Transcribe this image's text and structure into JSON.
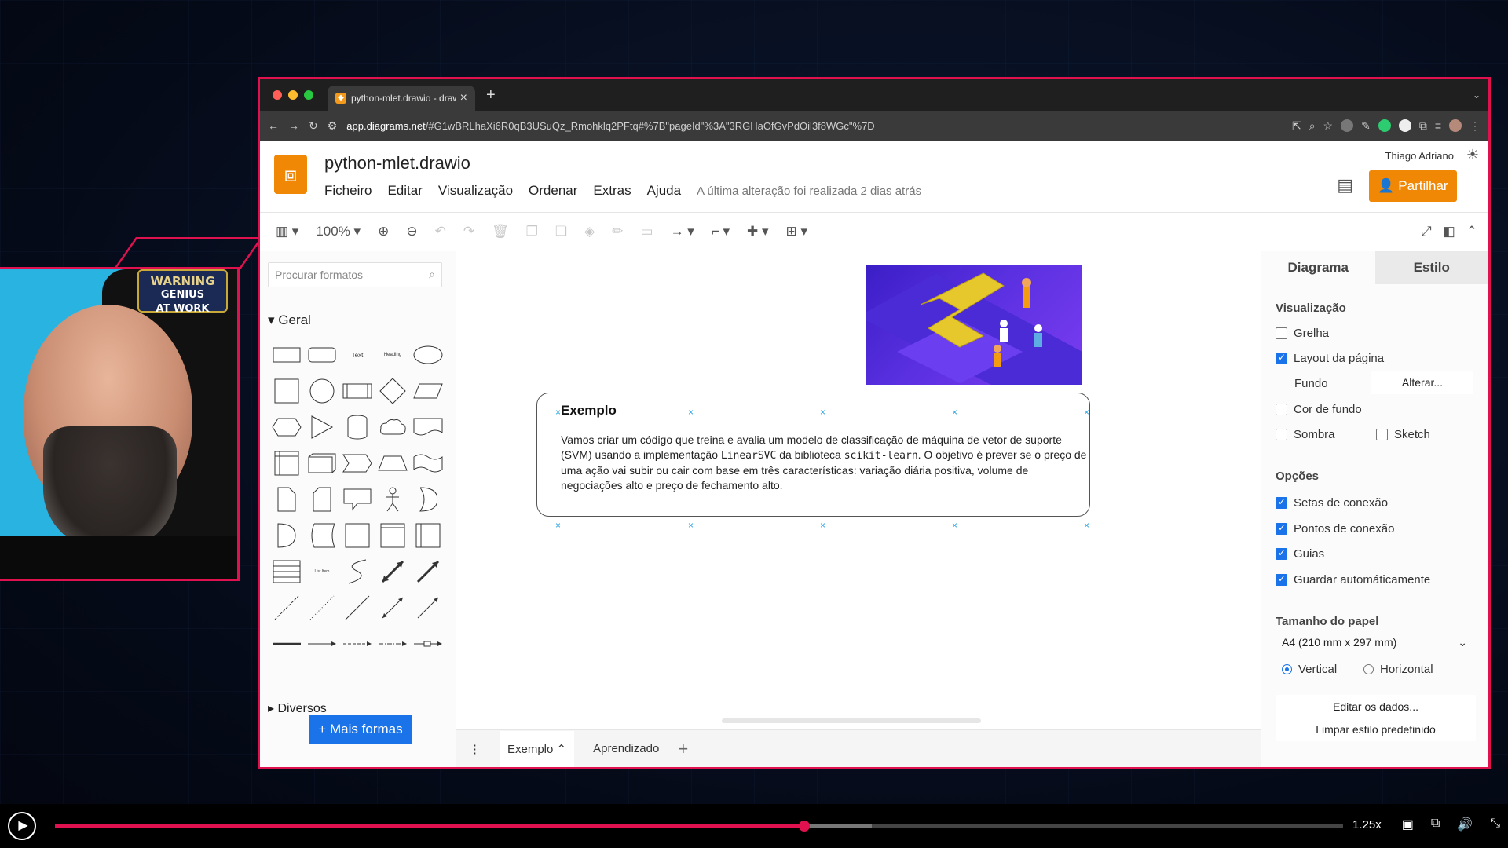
{
  "browser": {
    "tab_title": "python-mlet.drawio - draw.io",
    "tab_favicon": "drawio-favicon",
    "url_host": "app.diagrams.net",
    "url_path": "/#G1wBRLhaXi6R0qB3USuQz_Rmohklq2PFtq#%7B\"pageId\"%3A\"3RGHaOfGvPdOil3f8WGc\"%7D",
    "dot_colors": [
      "#ff5f57",
      "#febc2e",
      "#28c840"
    ]
  },
  "app": {
    "file_title": "python-mlet.drawio",
    "menu": [
      "Ficheiro",
      "Editar",
      "Visualização",
      "Ordenar",
      "Extras",
      "Ajuda"
    ],
    "last_edit": "A última alteração foi realizada 2 dias atrás",
    "user_name": "Thiago Adriano",
    "share_label": "Partilhar",
    "zoom": "100%",
    "accent": "#f08705"
  },
  "shapes_panel": {
    "search_placeholder": "Procurar formatos",
    "section_general": "Geral",
    "section_misc": "Diversos",
    "more_shapes": "+ Mais formas",
    "text_shape_label": "Text",
    "heading_shape_label": "Heading",
    "list_shape_label": "List Item"
  },
  "canvas": {
    "note_title": "Exemplo",
    "note_body_1": "Vamos criar um código que treina e avalia um modelo de classificação de máquina de vetor de suporte (SVM) usando a implementação ",
    "note_code_1": "LinearSVC",
    "note_body_2": " da biblioteca ",
    "note_code_2": "scikit-learn",
    "note_body_3": ". O objetivo é prever se o preço de uma ação vai subir ou cair com base em três características: variação diária positiva, volume de negociações alto e preço de fechamento alto."
  },
  "page_tabs": [
    "Exemplo",
    "Aprendizado"
  ],
  "format_panel": {
    "tab_diagram": "Diagrama",
    "tab_style": "Estilo",
    "view_heading": "Visualização",
    "grid": "Grelha",
    "page_layout": "Layout da página",
    "background": "Fundo",
    "change": "Alterar...",
    "bg_color": "Cor de fundo",
    "shadow": "Sombra",
    "sketch": "Sketch",
    "options_heading": "Opções",
    "connection_arrows": "Setas de conexão",
    "connection_points": "Pontos de conexão",
    "guides": "Guias",
    "autosave": "Guardar automáticamente",
    "paper_heading": "Tamanho do papel",
    "paper_size": "A4 (210 mm x 297 mm)",
    "portrait": "Vertical",
    "landscape": "Horizontal",
    "edit_data": "Editar os dados...",
    "clear_style": "Limpar estilo predefinido",
    "checked": {
      "grid": false,
      "page_layout": true,
      "bg_color": false,
      "shadow": false,
      "sketch": false,
      "connection_arrows": true,
      "connection_points": true,
      "guides": true,
      "autosave": true
    }
  },
  "webcam": {
    "sign_line1": "WARNING",
    "sign_line2": "GENIUS",
    "sign_line3": "AT WORK"
  },
  "player": {
    "speed": "1.25x",
    "progress": 0.582,
    "buffered": 0.634,
    "accent": "#e0114f"
  }
}
